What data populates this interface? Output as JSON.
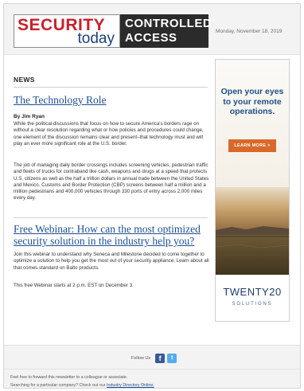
{
  "header": {
    "logo_word1": "SECURITY",
    "logo_word2": "today",
    "logo_badge_line1": "CONTROLLED",
    "logo_badge_line2": "ACCESS",
    "date": "Monday, November 18, 2019"
  },
  "main": {
    "section_label": "NEWS",
    "article1": {
      "title": "The Technology Role",
      "byline": "By Jim Ryan",
      "paragraph1": "While the political discussions that focus on how to secure America's borders rage on without a clear resolution regarding what or how policies and procedures could change, one element of the discussion remains clear and present–that technology must and will play an ever more significant role at the U.S. border.",
      "paragraph2": "The job of managing daily border crossings includes screening vehicles, pedestrian traffic and fleets of trucks for contraband like cash, weapons and drugs at a speed that protects U.S. citizens as well as the half a trillion dollars in annual trade between the United States and Mexico. Customs and Border Protection (CBP) screens between half a million and a million pedestrians and 400,000 vehicles through 330 ports of entry across 2,000 miles every day."
    },
    "article2": {
      "title": "Free Webinar: How can the most optimized security solution in the industry help you?",
      "paragraph1": "Join this webinar to understand why Seneca and Milestone decided to come together to optimize a solution to help you get the most out of your security appliance. Learn about all that comes standard on Balto products.",
      "paragraph2": "This free Webinar starts at 2 p.m. EST on December 3."
    }
  },
  "ad": {
    "headline": "Open your eyes to your remote operations.",
    "cta_label": "LEARN MORE >",
    "brand_name": "TWENTY20",
    "brand_sub": "SOLUTIONS"
  },
  "footer": {
    "follow_label": "Follow Us",
    "facebook_glyph": "f",
    "twitter_glyph": "t",
    "forward_text": "Feel free to forward this newsletter to a colleague or associate.",
    "search_text": "Searching for a particular company? Check out our",
    "directory_link": "Industry Directory Online."
  },
  "colors": {
    "brand_red": "#c8202b",
    "brand_blue": "#1c3f7a",
    "link_blue": "#1d4f91",
    "cta_orange": "#d9692a",
    "facebook_blue": "#3b5998",
    "twitter_blue": "#55acee"
  }
}
